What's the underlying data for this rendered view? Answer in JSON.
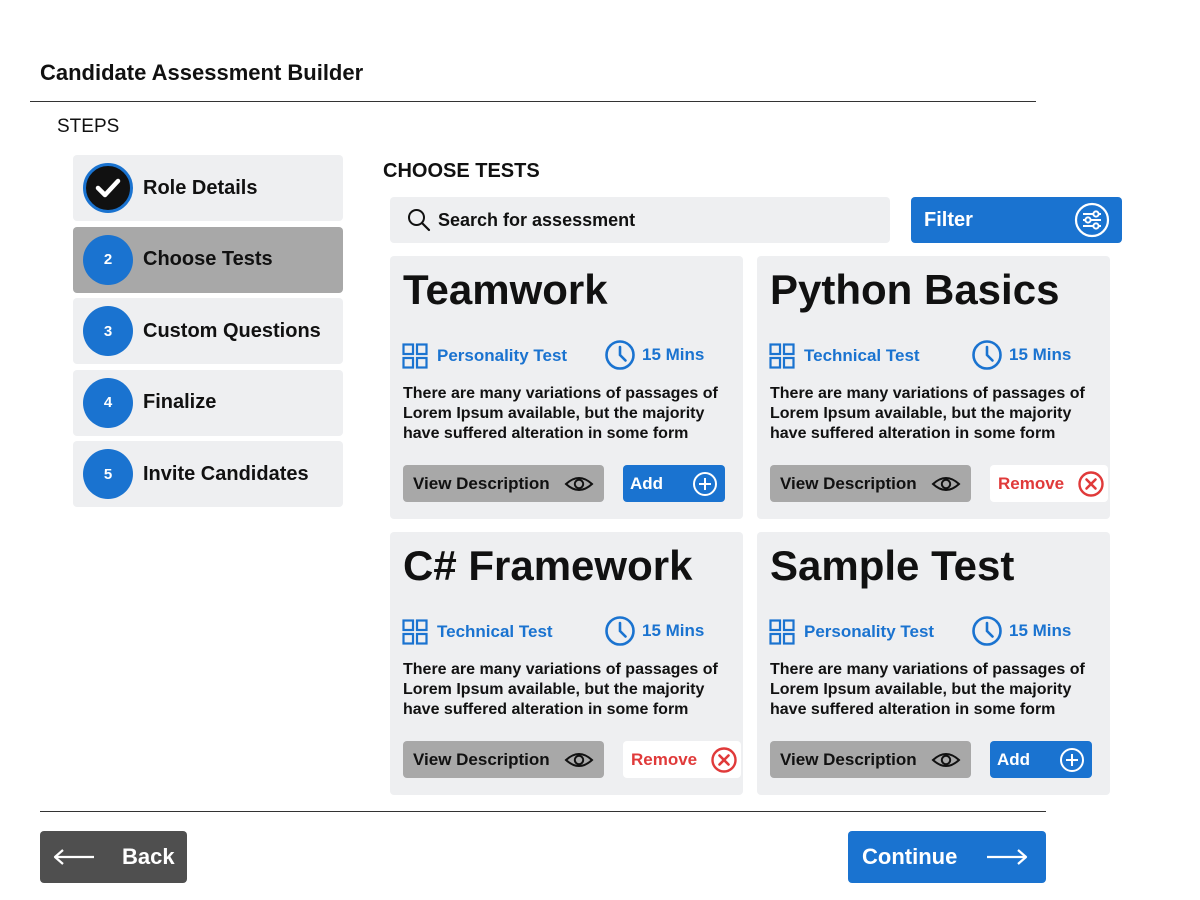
{
  "header": {
    "title": "Candidate Assessment Builder"
  },
  "steps": {
    "heading": "STEPS",
    "items": [
      {
        "number": "",
        "label": "Role Details",
        "state": "complete",
        "icon": "check-icon"
      },
      {
        "number": "2",
        "label": "Choose Tests",
        "state": "active"
      },
      {
        "number": "3",
        "label": "Custom Questions",
        "state": "pending"
      },
      {
        "number": "4",
        "label": "Finalize",
        "state": "pending"
      },
      {
        "number": "5",
        "label": "Invite Candidates",
        "state": "pending"
      }
    ]
  },
  "main": {
    "title": "CHOOSE TESTS",
    "search": {
      "placeholder": "Search for assessment",
      "value": ""
    },
    "filter": {
      "label": "Filter",
      "icon": "sliders-icon"
    },
    "cards": [
      {
        "title": "Teamwork",
        "type": "Personality Test",
        "duration": "15 Mins",
        "description": "There are many variations of passages of Lorem Ipsum available, but the majority have suffered alteration in some form",
        "view_label": "View Description",
        "action": "add",
        "action_label": "Add"
      },
      {
        "title": "Python Basics",
        "type": "Technical Test",
        "duration": "15 Mins",
        "description": "There are many variations of passages of Lorem Ipsum available, but the majority have suffered alteration in some form",
        "view_label": "View Description",
        "action": "remove",
        "action_label": "Remove"
      },
      {
        "title": "C# Framework",
        "type": "Technical Test",
        "duration": "15 Mins",
        "description": "There are many variations of passages of Lorem Ipsum available, but the majority have suffered alteration in some form",
        "view_label": "View Description",
        "action": "remove",
        "action_label": "Remove"
      },
      {
        "title": "Sample Test",
        "type": "Personality Test",
        "duration": "15 Mins",
        "description": "There are many variations of passages of Lorem Ipsum available, but the majority have suffered alteration in some form",
        "view_label": "View Description",
        "action": "add",
        "action_label": "Add"
      }
    ]
  },
  "footer": {
    "back_label": "Back",
    "continue_label": "Continue"
  },
  "colors": {
    "accent": "#1a73d0",
    "danger": "#e03a3a",
    "card_bg": "#eeeff1",
    "active_step": "#a8a8a8",
    "back_bg": "#4f4f4f"
  }
}
